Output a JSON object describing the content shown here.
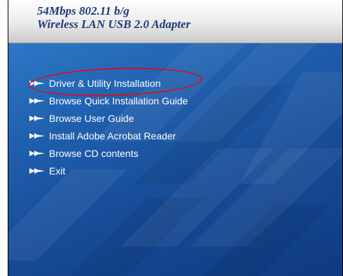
{
  "window": {
    "title_line1": "54Mbps 802.11 b/g",
    "title_line2": "Wireless LAN USB 2.0 Adapter"
  },
  "menu": {
    "items": [
      {
        "label": "Driver & Utility Installation",
        "highlighted": true
      },
      {
        "label": "Browse Quick Installation Guide"
      },
      {
        "label": "Browse User Guide"
      },
      {
        "label": "Install Adobe Acrobat Reader"
      },
      {
        "label": "Browse CD contents"
      },
      {
        "label": "Exit"
      }
    ],
    "bullet_icon": "arrow-right-icon"
  },
  "colors": {
    "title": "#1f3a7a",
    "background": "#1f5fae",
    "menu_text": "#ffffff",
    "highlight_ring": "#d8101c"
  }
}
